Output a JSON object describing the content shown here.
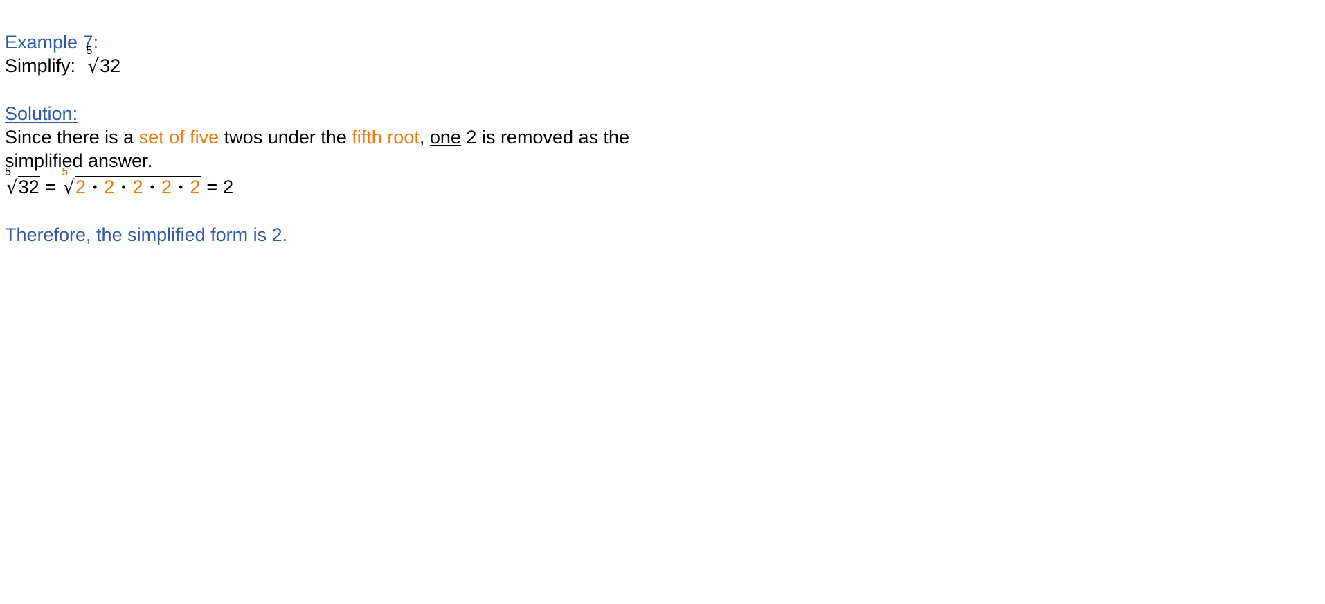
{
  "example": {
    "heading": "Example 7:",
    "prompt": "Simplify:",
    "radical": {
      "index": "5",
      "radicand": "32"
    }
  },
  "solution": {
    "heading": "Solution:",
    "sentence": {
      "part1": "Since there is a ",
      "highlight1": "set of five",
      "part2": " twos under the ",
      "highlight2": "fifth root",
      "part3": ", ",
      "underlined": "one",
      "part4": " 2 is removed as the",
      "line2": "simplified answer."
    },
    "equation": {
      "lhs_index": "5",
      "lhs_radicand": "32",
      "equals1": "=",
      "rhs_index": "5",
      "factors": [
        "2",
        "2",
        "2",
        "2",
        "2"
      ],
      "multiply_symbol": "•",
      "equals2": "=",
      "result": "2"
    },
    "conclusion": "Therefore, the simplified form is 2."
  },
  "colors": {
    "heading": "#2f5aa6",
    "highlight": "#f07810",
    "text": "#000000"
  }
}
